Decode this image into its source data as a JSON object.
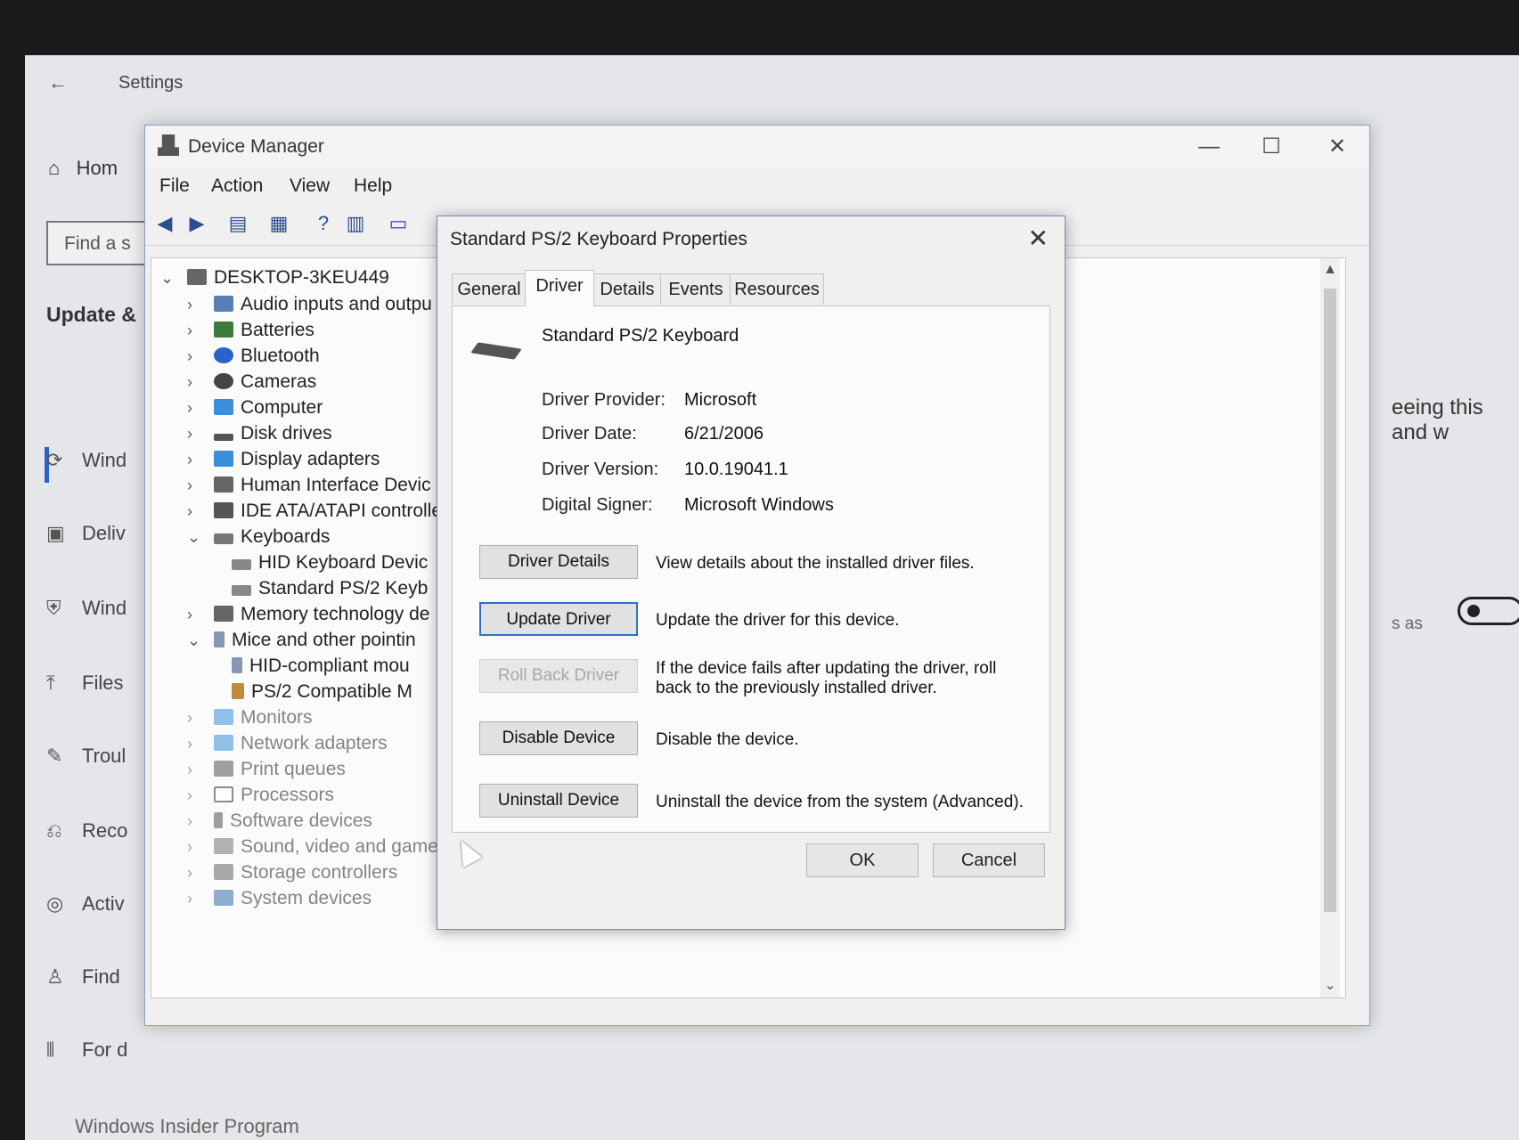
{
  "settings": {
    "title": "Settings",
    "home": "Hom",
    "find": "Find a s",
    "section": "Update &",
    "items": [
      {
        "icon": "sync-icon",
        "label": "Wind"
      },
      {
        "icon": "delivery-icon",
        "label": "Deliv"
      },
      {
        "icon": "shield-icon",
        "label": "Wind"
      },
      {
        "icon": "upload-icon",
        "label": "Files"
      },
      {
        "icon": "wrench-icon",
        "label": "Troul"
      },
      {
        "icon": "recovery-icon",
        "label": "Reco"
      },
      {
        "icon": "check-circle-icon",
        "label": "Activ"
      },
      {
        "icon": "person-icon",
        "label": "Find"
      },
      {
        "icon": "dev-icon",
        "label": "For d"
      }
    ],
    "insider": "Windows Insider Program",
    "right_text": "eeing this and w",
    "right_small": "s as"
  },
  "device_manager": {
    "title": "Device Manager",
    "menu": [
      "File",
      "Action",
      "View",
      "Help"
    ],
    "tree": {
      "root": "DESKTOP-3KEU449",
      "nodes": [
        {
          "label": "Audio inputs and outpu",
          "expanded": false
        },
        {
          "label": "Batteries",
          "expanded": false
        },
        {
          "label": "Bluetooth",
          "expanded": false
        },
        {
          "label": "Cameras",
          "expanded": false
        },
        {
          "label": "Computer",
          "expanded": false
        },
        {
          "label": "Disk drives",
          "expanded": false
        },
        {
          "label": "Display adapters",
          "expanded": false
        },
        {
          "label": "Human Interface Devic",
          "expanded": false
        },
        {
          "label": "IDE ATA/ATAPI controlle",
          "expanded": false
        },
        {
          "label": "Keyboards",
          "expanded": true
        },
        {
          "label": "HID Keyboard Devic",
          "child": true
        },
        {
          "label": "Standard PS/2 Keyb",
          "child": true
        },
        {
          "label": "Memory technology de",
          "expanded": false
        },
        {
          "label": "Mice and other pointin",
          "expanded": true
        },
        {
          "label": "HID-compliant mou",
          "child": true
        },
        {
          "label": "PS/2 Compatible M",
          "child": true
        },
        {
          "label": "Monitors",
          "expanded": false
        },
        {
          "label": "Network adapters",
          "expanded": false
        },
        {
          "label": "Print queues",
          "expanded": false
        },
        {
          "label": "Processors",
          "expanded": false
        },
        {
          "label": "Software devices",
          "expanded": false
        },
        {
          "label": "Sound, video and game",
          "expanded": false
        },
        {
          "label": "Storage controllers",
          "expanded": false
        },
        {
          "label": "System devices",
          "expanded": false
        }
      ]
    }
  },
  "dialog": {
    "title": "Standard PS/2 Keyboard Properties",
    "tabs": [
      "General",
      "Driver",
      "Details",
      "Events",
      "Resources"
    ],
    "active_tab": "Driver",
    "device_name": "Standard PS/2 Keyboard",
    "props": [
      {
        "label": "Driver Provider:",
        "value": "Microsoft"
      },
      {
        "label": "Driver Date:",
        "value": "6/21/2006"
      },
      {
        "label": "Driver Version:",
        "value": "10.0.19041.1"
      },
      {
        "label": "Digital Signer:",
        "value": "Microsoft Windows"
      }
    ],
    "actions": [
      {
        "button": "Driver Details",
        "desc": "View details about the installed driver files."
      },
      {
        "button": "Update Driver",
        "desc": "Update the driver for this device."
      },
      {
        "button": "Roll Back Driver",
        "desc": "If the device fails after updating the driver, roll back to the previously installed driver."
      },
      {
        "button": "Disable Device",
        "desc": "Disable the device."
      },
      {
        "button": "Uninstall Device",
        "desc": "Uninstall the device from the system (Advanced)."
      }
    ],
    "ok": "OK",
    "cancel": "Cancel"
  }
}
